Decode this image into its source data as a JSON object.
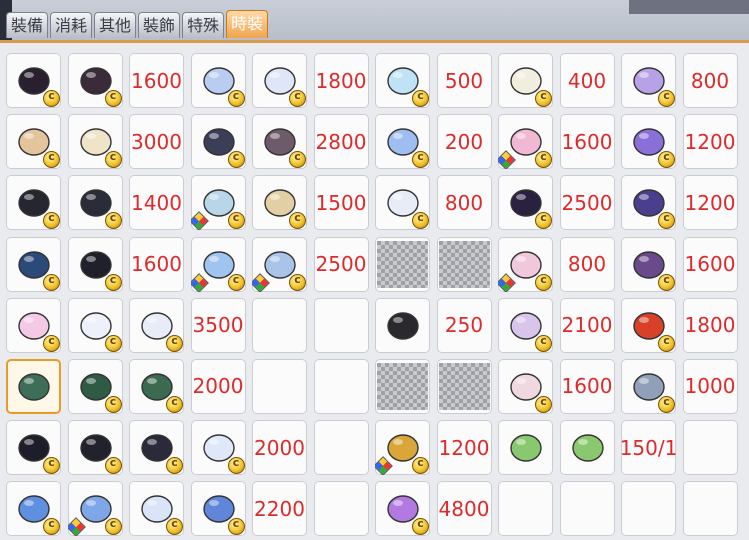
{
  "tabs": [
    {
      "label": "裝備"
    },
    {
      "label": "消耗"
    },
    {
      "label": "其他"
    },
    {
      "label": "裝飾"
    },
    {
      "label": "特殊"
    },
    {
      "label": "時裝"
    }
  ],
  "active_tab": "時裝",
  "slots": [
    {
      "kind": "item",
      "icon": "black-beret-icon",
      "color": "#2a1f2e",
      "coin": true
    },
    {
      "kind": "item",
      "icon": "dark-hoodie-icon",
      "color": "#3b2a3a",
      "coin": true
    },
    {
      "kind": "price",
      "text": "1600"
    },
    {
      "kind": "item",
      "icon": "cat-ear-hat-icon",
      "color": "#b9cdf2",
      "coin": true
    },
    {
      "kind": "item",
      "icon": "white-outfit-icon",
      "color": "#dfe6f7",
      "coin": true
    },
    {
      "kind": "price",
      "text": "1800"
    },
    {
      "kind": "item",
      "icon": "bird-hat-icon",
      "color": "#bfe3f5",
      "coin": true
    },
    {
      "kind": "price",
      "text": "500"
    },
    {
      "kind": "item",
      "icon": "white-shirt-icon",
      "color": "#f1eddf",
      "coin": true
    },
    {
      "kind": "price",
      "text": "400"
    },
    {
      "kind": "item",
      "icon": "magic-wand-icon",
      "color": "#b7a2e8",
      "coin": true
    },
    {
      "kind": "price",
      "text": "800"
    },
    {
      "kind": "item",
      "icon": "tan-cap-icon",
      "color": "#e4c49a",
      "coin": true
    },
    {
      "kind": "item",
      "icon": "cream-uniform-icon",
      "color": "#efe3c8",
      "coin": true
    },
    {
      "kind": "price",
      "text": "3000"
    },
    {
      "kind": "item",
      "icon": "dark-cape-icon",
      "color": "#3a3e57",
      "coin": true
    },
    {
      "kind": "item",
      "icon": "boots-sparkle-icon",
      "color": "#6d5a6a",
      "coin": true
    },
    {
      "kind": "price",
      "text": "2800"
    },
    {
      "kind": "item",
      "icon": "blue-bucket-hat-icon",
      "color": "#9ebdf0",
      "coin": true
    },
    {
      "kind": "price",
      "text": "200"
    },
    {
      "kind": "item",
      "icon": "pink-jacket-icon",
      "color": "#f2b7d2",
      "coin": true,
      "cube": true
    },
    {
      "kind": "price",
      "text": "1600"
    },
    {
      "kind": "item",
      "icon": "purple-aura-icon",
      "color": "#8a6fd8",
      "coin": true
    },
    {
      "kind": "price",
      "text": "1200"
    },
    {
      "kind": "item",
      "icon": "black-sailor-outfit-icon",
      "color": "#262630",
      "coin": true
    },
    {
      "kind": "item",
      "icon": "black-boots-icon",
      "color": "#2a2d38",
      "coin": true
    },
    {
      "kind": "price",
      "text": "1400"
    },
    {
      "kind": "item",
      "icon": "sailor-cap-icon",
      "color": "#b9d6e8",
      "coin": true,
      "cube": true
    },
    {
      "kind": "item",
      "icon": "school-uniform-icon",
      "color": "#e3cfa4",
      "coin": true
    },
    {
      "kind": "price",
      "text": "1500"
    },
    {
      "kind": "item",
      "icon": "white-cap-icon",
      "color": "#e8ecf7",
      "coin": true
    },
    {
      "kind": "price",
      "text": "800"
    },
    {
      "kind": "item",
      "icon": "purple-hoodie-icon",
      "color": "#2a2140",
      "coin": true
    },
    {
      "kind": "price",
      "text": "2500"
    },
    {
      "kind": "item",
      "icon": "cat-shadow-aura-icon",
      "color": "#4a3f8e",
      "coin": true
    },
    {
      "kind": "price",
      "text": "1200"
    },
    {
      "kind": "item",
      "icon": "blue-cat-hat-icon",
      "color": "#2b4a7a",
      "coin": true
    },
    {
      "kind": "item",
      "icon": "black-hood-icon",
      "color": "#20202a",
      "coin": true
    },
    {
      "kind": "price",
      "text": "1600"
    },
    {
      "kind": "item",
      "icon": "blue-dress-icon",
      "color": "#9fc4f0",
      "coin": true,
      "cube": true
    },
    {
      "kind": "item",
      "icon": "blue-boots-icon",
      "color": "#a9c4e8",
      "coin": true,
      "cube": true
    },
    {
      "kind": "price",
      "text": "2500"
    },
    {
      "kind": "blur"
    },
    {
      "kind": "blur"
    },
    {
      "kind": "item",
      "icon": "pink-shorts-icon",
      "color": "#f0c8dc",
      "coin": true,
      "cube": true
    },
    {
      "kind": "price",
      "text": "800"
    },
    {
      "kind": "item",
      "icon": "teddy-bear-aura-icon",
      "color": "#6a4a8a",
      "coin": true
    },
    {
      "kind": "price",
      "text": "1600"
    },
    {
      "kind": "item",
      "icon": "pink-bunny-hat-icon",
      "color": "#f4c9e6",
      "coin": true
    },
    {
      "kind": "item",
      "icon": "white-dress-icon",
      "color": "#eef0fa",
      "coin": true
    },
    {
      "kind": "item",
      "icon": "white-cape-icon",
      "color": "#e8ecf8",
      "coin": true
    },
    {
      "kind": "price",
      "text": "3500"
    },
    {
      "kind": "empty"
    },
    {
      "kind": "empty"
    },
    {
      "kind": "item",
      "icon": "black-bow-icon",
      "color": "#2a2a2e",
      "coin": false
    },
    {
      "kind": "price",
      "text": "250"
    },
    {
      "kind": "item",
      "icon": "lilac-skirt-icon",
      "color": "#d9c4ec",
      "coin": true
    },
    {
      "kind": "price",
      "text": "2100"
    },
    {
      "kind": "item",
      "icon": "red-gem-icon",
      "color": "#d8402a",
      "coin": true
    },
    {
      "kind": "price",
      "text": "1800"
    },
    {
      "kind": "item",
      "icon": "green-cloak-icon",
      "color": "#3f6e58",
      "coin": false,
      "selected": true
    },
    {
      "kind": "item",
      "icon": "leaf-wings-icon",
      "color": "#2f5a44",
      "coin": true
    },
    {
      "kind": "item",
      "icon": "green-scythe-icon",
      "color": "#3b6a50",
      "coin": true
    },
    {
      "kind": "price",
      "text": "2000"
    },
    {
      "kind": "empty"
    },
    {
      "kind": "empty"
    },
    {
      "kind": "blur"
    },
    {
      "kind": "blur"
    },
    {
      "kind": "item",
      "icon": "pink-boots-icon",
      "color": "#f0d8e0",
      "coin": true
    },
    {
      "kind": "price",
      "text": "1600"
    },
    {
      "kind": "item",
      "icon": "mech-staff-icon",
      "color": "#8fa0b8",
      "coin": true
    },
    {
      "kind": "price",
      "text": "1000"
    },
    {
      "kind": "item",
      "icon": "witch-hat-icon",
      "color": "#1e1e2a",
      "coin": true
    },
    {
      "kind": "item",
      "icon": "black-bow-outfit-icon",
      "color": "#22222c",
      "coin": true
    },
    {
      "kind": "item",
      "icon": "dark-bunny-suit-icon",
      "color": "#2a2a3a",
      "coin": true
    },
    {
      "kind": "item",
      "icon": "white-bunny-icon",
      "color": "#dfe8f8",
      "coin": true
    },
    {
      "kind": "price",
      "text": "2000"
    },
    {
      "kind": "empty"
    },
    {
      "kind": "item",
      "icon": "gold-scroll-icon",
      "color": "#d9a63a",
      "coin": true,
      "cube": true
    },
    {
      "kind": "price",
      "text": "1200"
    },
    {
      "kind": "item",
      "icon": "green-pet-box-icon",
      "color": "#8ac870",
      "coin": false
    },
    {
      "kind": "item",
      "icon": "green-pet-box-icon",
      "color": "#8ac870",
      "coin": false
    },
    {
      "kind": "price",
      "text": "150/1"
    },
    {
      "kind": "empty"
    },
    {
      "kind": "item",
      "icon": "blue-beret-icon",
      "color": "#5f8fe0",
      "coin": true
    },
    {
      "kind": "item",
      "icon": "blue-flower-boots-icon",
      "color": "#7fa6e8",
      "coin": true,
      "cube": true
    },
    {
      "kind": "item",
      "icon": "white-blue-dress-icon",
      "color": "#d9e4f8",
      "coin": true
    },
    {
      "kind": "item",
      "icon": "blue-wand-icon",
      "color": "#5f86d8",
      "coin": true
    },
    {
      "kind": "price",
      "text": "2200"
    },
    {
      "kind": "empty"
    },
    {
      "kind": "item",
      "icon": "gold-ring-icon",
      "color": "#b27ae0",
      "coin": true
    },
    {
      "kind": "price",
      "text": "4800"
    },
    {
      "kind": "empty"
    },
    {
      "kind": "empty"
    },
    {
      "kind": "empty"
    },
    {
      "kind": "empty"
    }
  ]
}
